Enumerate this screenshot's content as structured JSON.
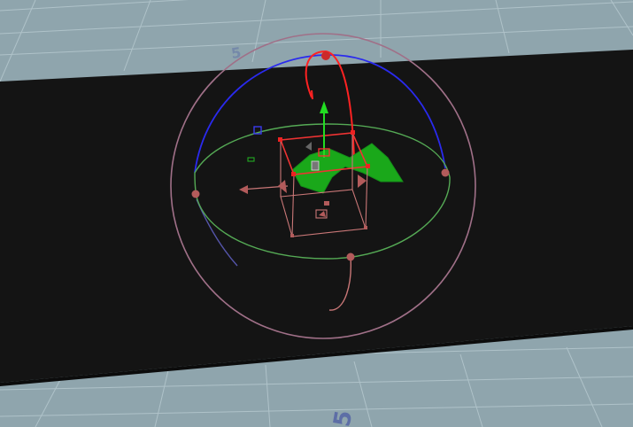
{
  "viewport": {
    "grid_label_near": "5",
    "grid_label_far": "5"
  },
  "colors": {
    "grid_background": "#8fa5ad",
    "grid_line": "#b3c7cd",
    "backdrop": "#131313",
    "x_axis": "#ff2222",
    "y_axis": "#22dd22",
    "z_axis": "#2a2aee",
    "rotate_ring": "#a07088",
    "selection": "#c97777",
    "mesh": "#1aa81a",
    "handle": "#b35b5b"
  },
  "gizmo": {
    "type": "transform-gizmo",
    "rings": [
      "outer-rotate-ring",
      "z-rotate-ring",
      "y-rotate-ring",
      "x-rotate-ring"
    ]
  },
  "object": {
    "name_icon": "mesh-object",
    "selected": true
  }
}
